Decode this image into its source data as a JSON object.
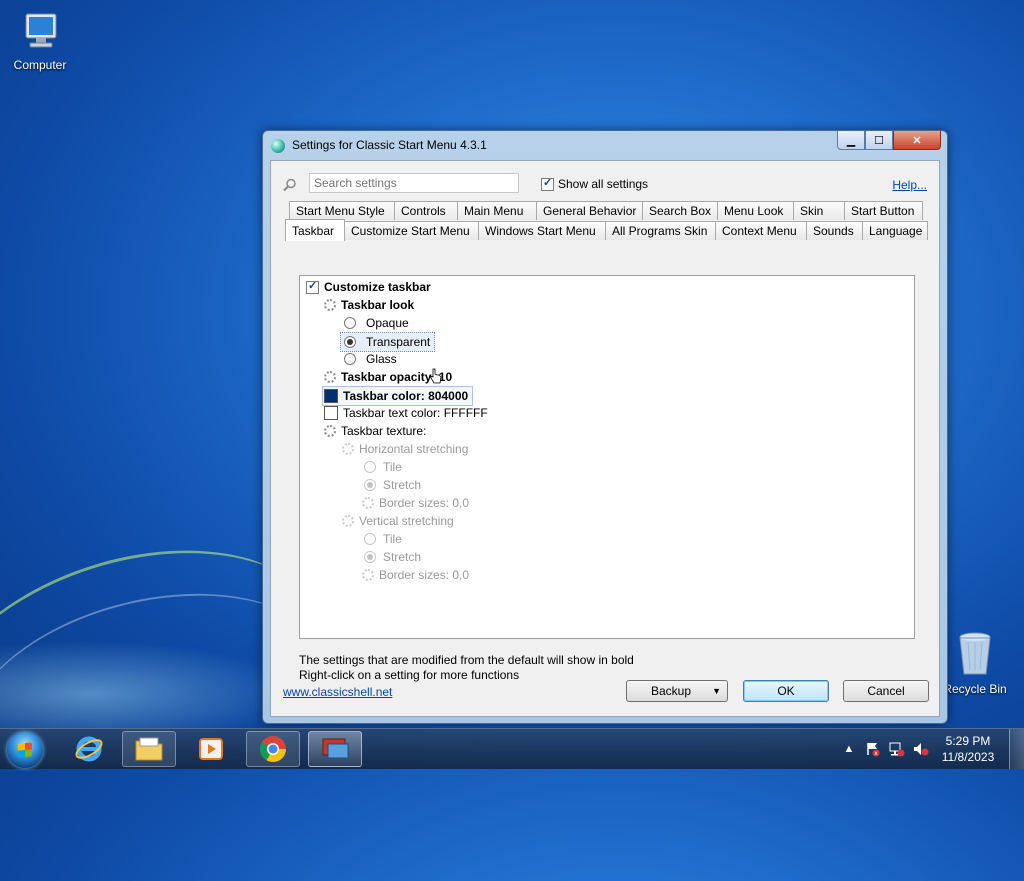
{
  "desktop": {
    "icons": [
      {
        "label": "Computer",
        "icon": "computer-icon"
      },
      {
        "label": "Recycle Bin",
        "icon": "recycle-bin-icon"
      }
    ]
  },
  "window": {
    "title": "Settings for Classic Start Menu 4.3.1",
    "search_placeholder": "Search settings",
    "show_all_label": "Show all settings",
    "help_label": "Help...",
    "tabs_row1": [
      "Start Menu Style",
      "Controls",
      "Main Menu",
      "General Behavior",
      "Search Box",
      "Menu Look",
      "Skin",
      "Start Button"
    ],
    "tabs_row2": [
      "Taskbar",
      "Customize Start Menu",
      "Windows Start Menu",
      "All Programs Skin",
      "Context Menu",
      "Sounds",
      "Language"
    ],
    "active_tab": "Taskbar",
    "settings": {
      "customize_taskbar": "Customize taskbar",
      "taskbar_look": "Taskbar look",
      "opaque": "Opaque",
      "transparent": "Transparent",
      "glass": "Glass",
      "taskbar_opacity": "Taskbar opacity: 10",
      "taskbar_color": "Taskbar color: 804000",
      "taskbar_text_color": "Taskbar text color: FFFFFF",
      "taskbar_texture": "Taskbar texture:",
      "horizontal_stretching": "Horizontal stretching",
      "h_tile": "Tile",
      "h_stretch": "Stretch",
      "h_border": "Border sizes: 0,0",
      "vertical_stretching": "Vertical stretching",
      "v_tile": "Tile",
      "v_stretch": "Stretch",
      "v_border": "Border sizes: 0,0"
    },
    "taskbar_color_swatch": "#003070",
    "taskbar_text_color_swatch": "#FFFFFF",
    "note_line1": "The settings that are modified from the default will show in bold",
    "note_line2": "Right-click on a setting for more functions",
    "footer_link": "www.classicshell.net",
    "backup_label": "Backup",
    "ok_label": "OK",
    "cancel_label": "Cancel"
  },
  "taskbar": {
    "time": "5:29 PM",
    "date": "11/8/2023",
    "apps": [
      "internet-explorer-icon",
      "file-explorer-icon",
      "media-player-icon",
      "chrome-icon",
      "classic-shell-settings-icon"
    ]
  }
}
